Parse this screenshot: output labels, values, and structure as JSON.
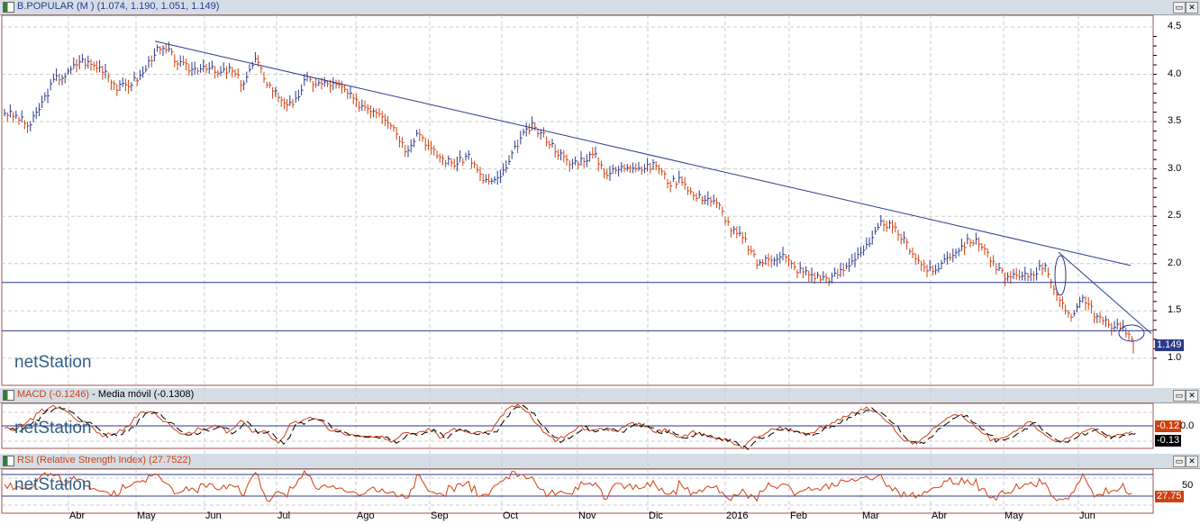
{
  "main": {
    "title": "B.POPULAR (M ) (1.074, 1.190, 1.051, 1.149)",
    "last_price": "1.149",
    "y_ticks": [
      "4.5",
      "4.0",
      "3.5",
      "3.0",
      "2.5",
      "2.0",
      "1.5",
      "1.0"
    ]
  },
  "macd": {
    "title_macd": "MACD (-0.1246)",
    "title_ma": "Media móvil (-0.1308)",
    "tag1": "-0.12",
    "tag2": "-0.13",
    "tick": "0.0"
  },
  "rsi": {
    "title": "RSI (Relative Strength Index) (27.7522)",
    "tag": "27.75",
    "tick": "50"
  },
  "logo": "netStation",
  "months": [
    "Abr",
    "May",
    "Jun",
    "Jul",
    "Ago",
    "Sep",
    "Oct",
    "Nov",
    "Dic",
    "2016",
    "Feb",
    "Mar",
    "Abr",
    "May",
    "Jun"
  ],
  "colors": {
    "up": "#2b3a8c",
    "down": "#d04010",
    "line": "#2b3a8c"
  },
  "chart_data": {
    "type": "ohlc",
    "title": "B.POPULAR",
    "ylim": [
      0.9,
      4.6
    ],
    "closes": [
      3.6,
      3.55,
      3.45,
      3.7,
      3.95,
      4.0,
      4.15,
      4.1,
      4.05,
      3.85,
      3.9,
      4.0,
      4.25,
      4.25,
      4.1,
      4.05,
      4.1,
      4.0,
      4.05,
      3.9,
      4.15,
      3.9,
      3.75,
      3.65,
      3.95,
      3.9,
      3.9,
      3.85,
      3.7,
      3.65,
      3.6,
      3.45,
      3.2,
      3.4,
      3.2,
      3.1,
      3.05,
      3.15,
      2.9,
      2.85,
      3.0,
      3.3,
      3.45,
      3.35,
      3.2,
      3.05,
      3.1,
      3.15,
      2.95,
      3.0,
      3.05,
      3.0,
      3.05,
      2.85,
      2.9,
      2.7,
      2.7,
      2.6,
      2.35,
      2.25,
      2.0,
      2.05,
      2.1,
      1.95,
      1.9,
      1.85,
      1.85,
      1.95,
      2.1,
      2.2,
      2.45,
      2.35,
      2.2,
      2.0,
      1.9,
      2.05,
      2.15,
      2.25,
      2.2,
      1.95,
      1.85,
      1.85,
      1.9,
      2.0,
      1.6,
      1.45,
      1.65,
      1.45,
      1.35,
      1.35,
      1.15
    ],
    "horizontal_levels": [
      1.8,
      1.29
    ],
    "macd_last": -0.1246,
    "macd_ma_last": -0.1308,
    "rsi_last": 27.7522
  }
}
